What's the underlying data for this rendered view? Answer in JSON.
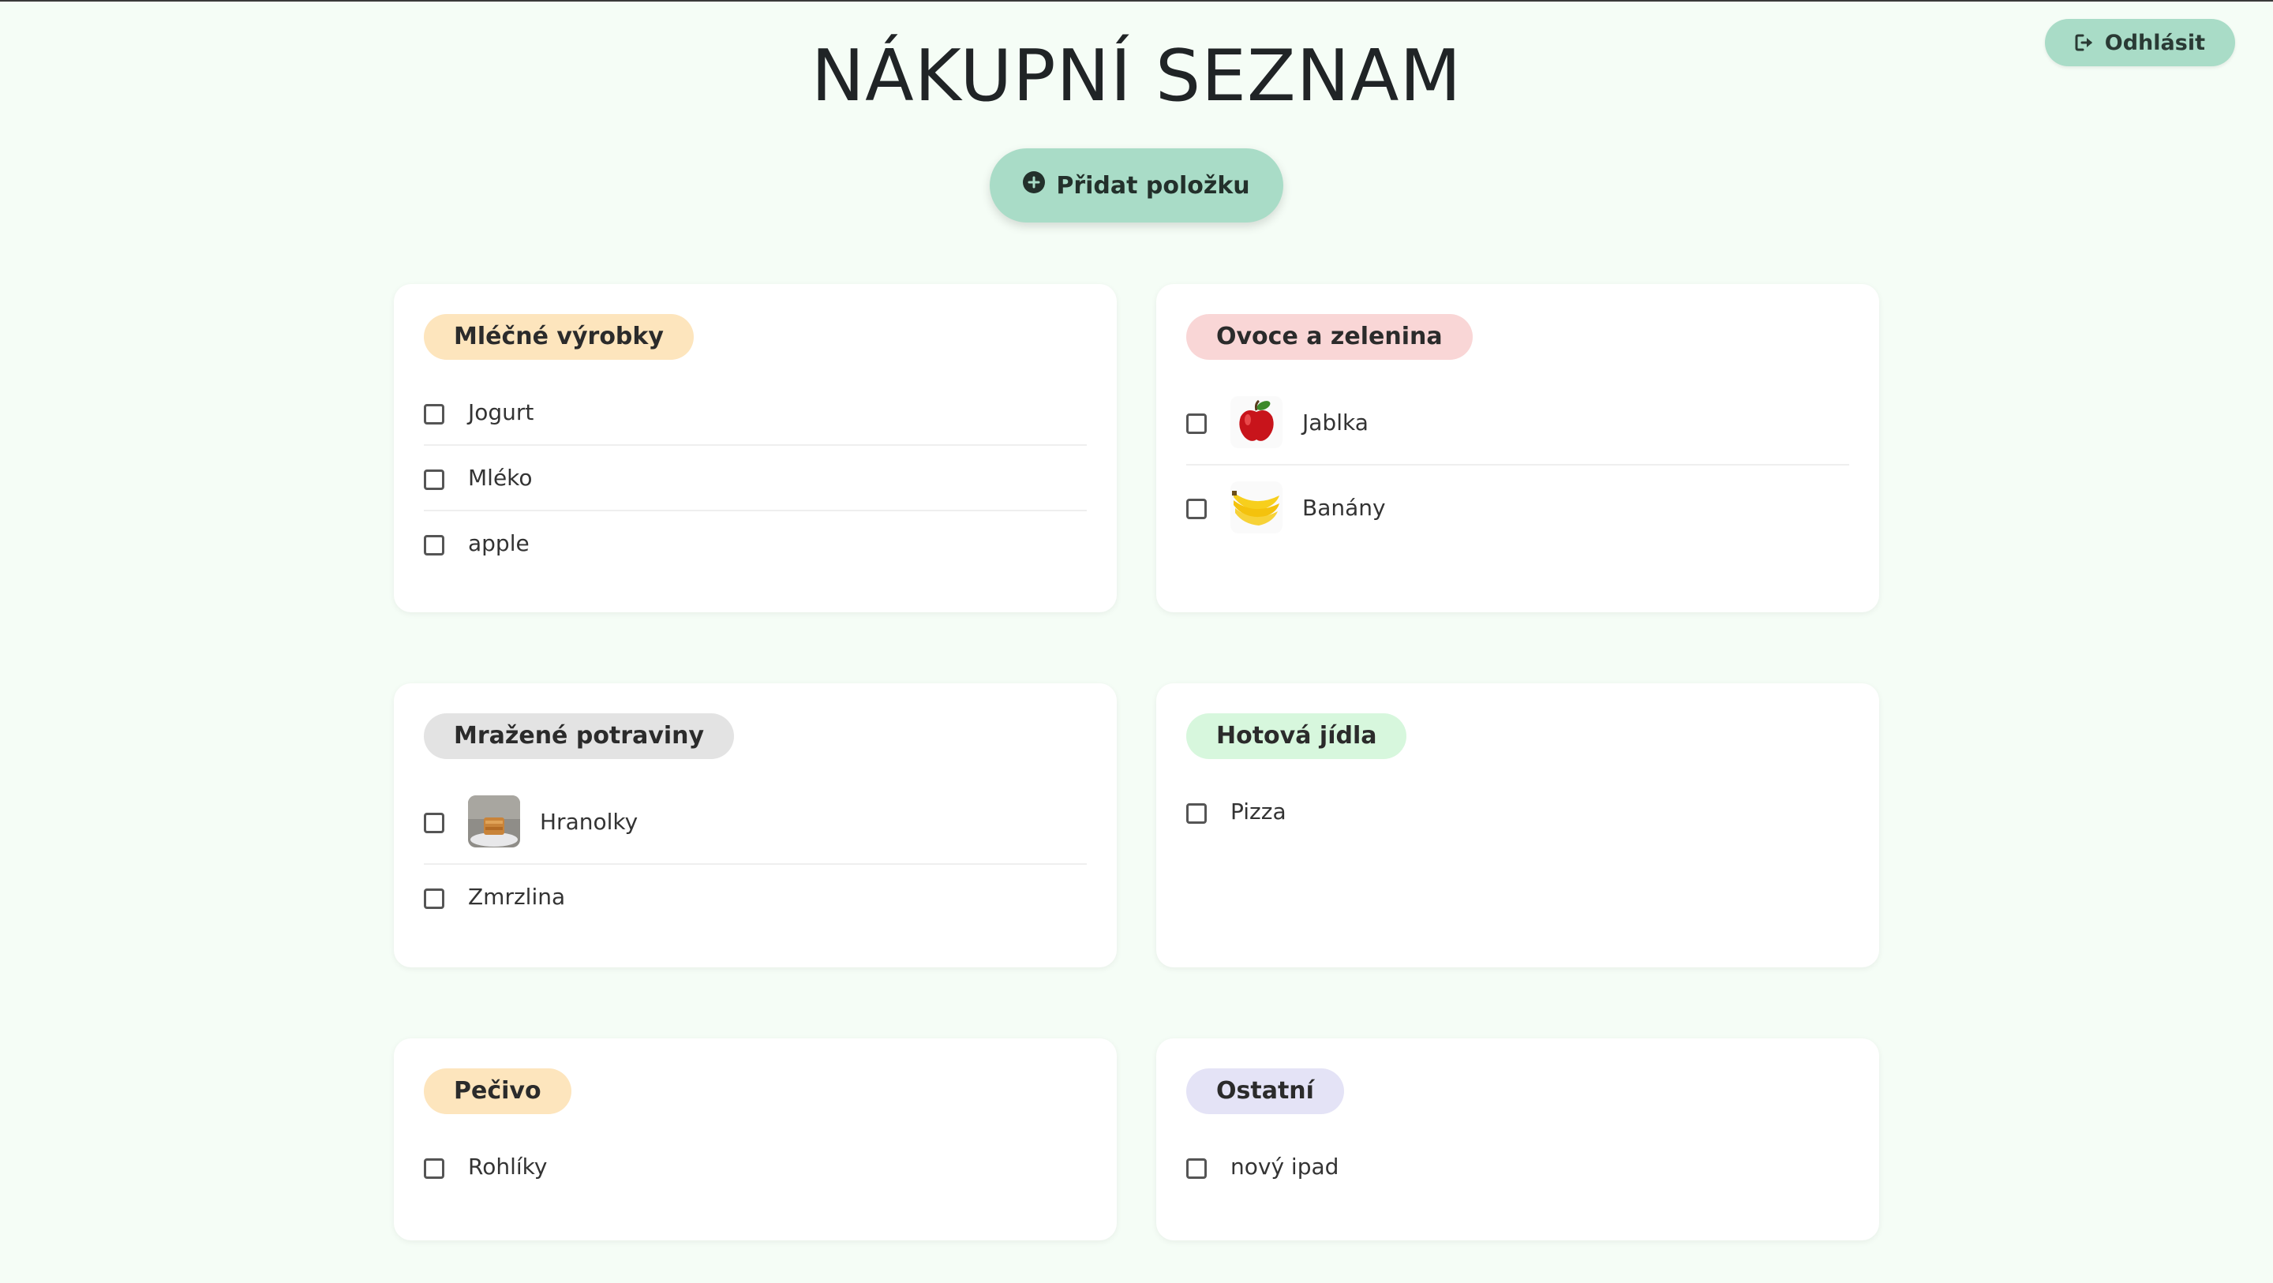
{
  "header": {
    "title": "NÁKUPNÍ SEZNAM",
    "logout_label": "Odhlásit",
    "add_item_label": "Přidat položku"
  },
  "colors": {
    "accent": "#a9dcc7",
    "background": "#f5fdf6"
  },
  "categories": [
    {
      "name": "Mléčné výrobky",
      "color": "#fde5bd",
      "items": [
        {
          "label": "Jogurt",
          "checked": false
        },
        {
          "label": "Mléko",
          "checked": false
        },
        {
          "label": "apple",
          "checked": false
        }
      ]
    },
    {
      "name": "Ovoce a zelenina",
      "color": "#f9d6d6",
      "items": [
        {
          "label": "Jablka",
          "checked": false,
          "image": "apple-image"
        },
        {
          "label": "Banány",
          "checked": false,
          "image": "banana-image"
        }
      ]
    },
    {
      "name": "Mražené potraviny",
      "color": "#e3e3e3",
      "items": [
        {
          "label": "Hranolky",
          "checked": false,
          "image": "fries-image"
        },
        {
          "label": "Zmrzlina",
          "checked": false
        }
      ]
    },
    {
      "name": "Hotová jídla",
      "color": "#d7f7dd",
      "items": [
        {
          "label": "Pizza",
          "checked": false
        }
      ]
    },
    {
      "name": "Pečivo",
      "color": "#fde5bd",
      "items": [
        {
          "label": "Rohlíky",
          "checked": false
        }
      ]
    },
    {
      "name": "Ostatní",
      "color": "#e4e3f6",
      "items": [
        {
          "label": "nový ipad",
          "checked": false
        }
      ]
    }
  ]
}
